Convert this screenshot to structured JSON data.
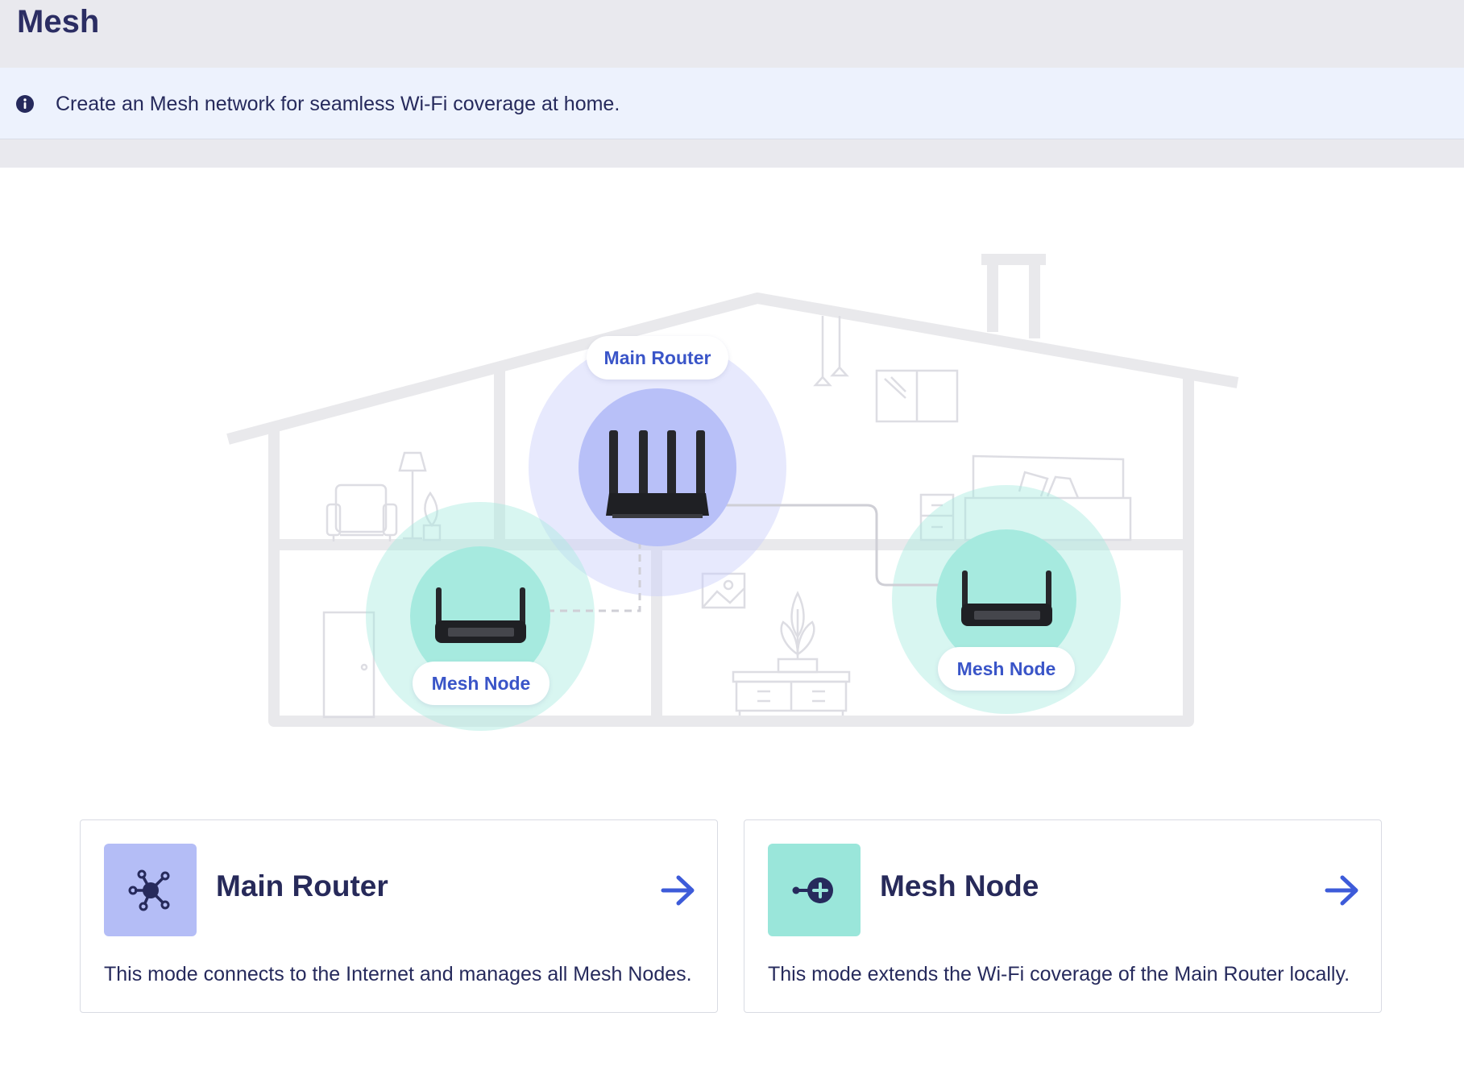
{
  "header": {
    "title": "Mesh"
  },
  "info": {
    "icon": "info-circle-icon",
    "text": "Create an Mesh network for seamless Wi-Fi coverage at home."
  },
  "illustration": {
    "main_router_label": "Main Router",
    "mesh_node_left_label": "Mesh Node",
    "mesh_node_right_label": "Mesh Node"
  },
  "cards": [
    {
      "title": "Main Router",
      "description": "This mode connects to the Internet and manages all Mesh Nodes.",
      "icon": "hub-network-icon",
      "icon_bg": "#b4bdf6",
      "arrow": "arrow-right-icon"
    },
    {
      "title": "Mesh Node",
      "description": "This mode extends the Wi-Fi coverage of the Main Router locally.",
      "icon": "node-plus-icon",
      "icon_bg": "#9ae6da",
      "arrow": "arrow-right-icon"
    }
  ],
  "colors": {
    "accent": "#3d5bd9",
    "title": "#272a5a",
    "info_bg": "#edf2fd",
    "router_circle": "#c6cdfa",
    "node_circle": "#b3ede2"
  }
}
